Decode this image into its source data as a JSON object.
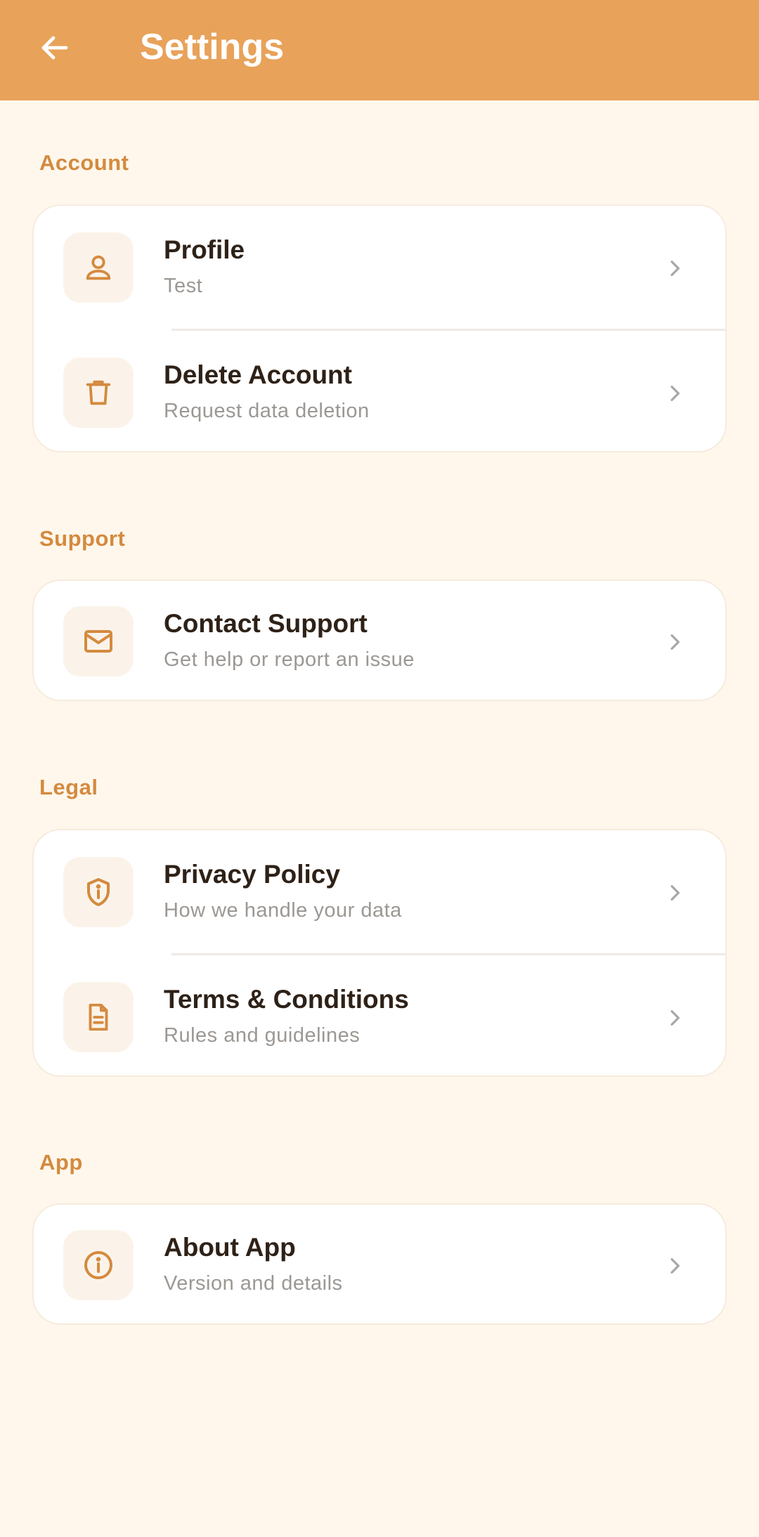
{
  "header": {
    "title": "Settings",
    "back_icon": "arrow-left-icon",
    "background_color": "#E8A25A"
  },
  "accent_color": "#D48A3E",
  "sections": [
    {
      "label": "Account",
      "items": [
        {
          "title": "Profile",
          "subtitle": "Test",
          "icon": "person-icon"
        },
        {
          "title": "Delete Account",
          "subtitle": "Request data deletion",
          "icon": "trash-icon"
        }
      ]
    },
    {
      "label": "Support",
      "items": [
        {
          "title": "Contact Support",
          "subtitle": "Get help or report an issue",
          "icon": "mail-icon"
        }
      ]
    },
    {
      "label": "Legal",
      "items": [
        {
          "title": "Privacy Policy",
          "subtitle": "How we handle your data",
          "icon": "shield-info-icon"
        },
        {
          "title": "Terms & Conditions",
          "subtitle": "Rules and guidelines",
          "icon": "document-icon"
        }
      ]
    },
    {
      "label": "App",
      "items": [
        {
          "title": "About App",
          "subtitle": "Version and details",
          "icon": "info-circle-icon"
        }
      ]
    }
  ]
}
